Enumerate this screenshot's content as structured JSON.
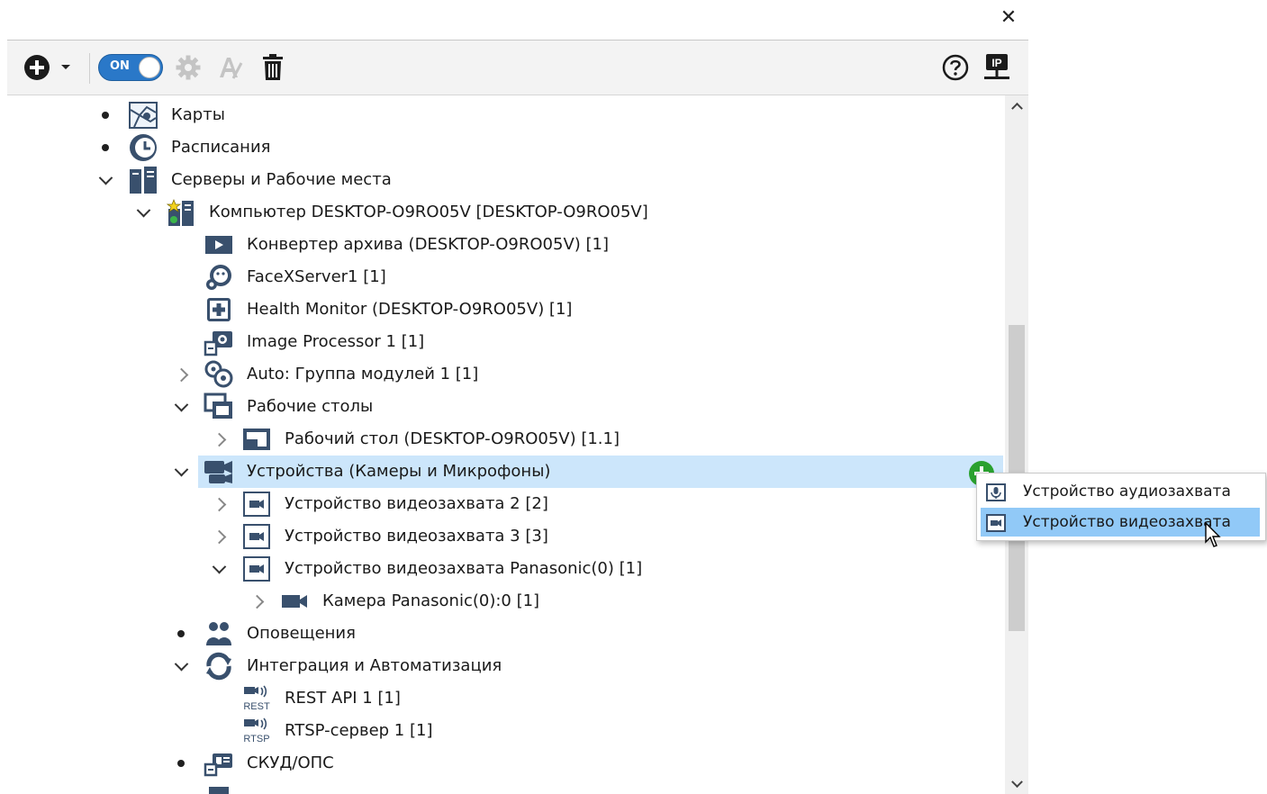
{
  "window": {
    "close_glyph": "✕"
  },
  "toolbar": {
    "add_icon": "plus-circle-icon",
    "toggle_label": "ON",
    "settings_icon": "gear-icon",
    "rename_icon": "rename-icon",
    "delete_icon": "trash-icon",
    "help_icon": "question-icon",
    "ip_icon": "ip-network-icon"
  },
  "tree": {
    "items": [
      {
        "label": "Карты",
        "icon": "map-icon",
        "marker": "bullet"
      },
      {
        "label": "Расписания",
        "icon": "clock-icon",
        "marker": "bullet"
      },
      {
        "label": "Серверы и Рабочие места",
        "icon": "servers-icon",
        "marker": "expanded"
      },
      {
        "label": "Компьютер DESKTOP-O9RO05V [DESKTOP-O9RO05V]",
        "icon": "computer-server-icon",
        "marker": "expanded"
      },
      {
        "label": "Конвертер архива (DESKTOP-O9RO05V) [1]",
        "icon": "archive-converter-icon",
        "marker": "none"
      },
      {
        "label": "FaceXServer1 [1]",
        "icon": "face-server-icon",
        "marker": "none"
      },
      {
        "label": "Health Monitor (DESKTOP-O9RO05V) [1]",
        "icon": "health-monitor-icon",
        "marker": "none"
      },
      {
        "label": "Image Processor 1 [1]",
        "icon": "image-processor-icon",
        "marker": "none"
      },
      {
        "label": "Auto: Группа модулей 1 [1]",
        "icon": "module-group-icon",
        "marker": "collapsed"
      },
      {
        "label": "Рабочие столы",
        "icon": "desktops-icon",
        "marker": "expanded"
      },
      {
        "label": "Рабочий стол (DESKTOP-O9RO05V) [1.1]",
        "icon": "desktop-icon",
        "marker": "collapsed"
      },
      {
        "label": "Устройства (Камеры и Микрофоны)",
        "icon": "devices-icon",
        "marker": "expanded",
        "selected": true
      },
      {
        "label": "Устройство видеозахвата 2 [2]",
        "icon": "video-capture-icon",
        "marker": "collapsed"
      },
      {
        "label": "Устройство видеозахвата 3 [3]",
        "icon": "video-capture-icon",
        "marker": "collapsed"
      },
      {
        "label": "Устройство видеозахвата Panasonic(0) [1]",
        "icon": "video-capture-icon",
        "marker": "expanded"
      },
      {
        "label": "Камера Panasonic(0):0 [1]",
        "icon": "camera-icon",
        "marker": "collapsed"
      },
      {
        "label": "Оповещения",
        "icon": "notifications-icon",
        "marker": "bullet"
      },
      {
        "label": "Интеграция и Автоматизация",
        "icon": "integration-icon",
        "marker": "expanded"
      },
      {
        "label": "REST API 1 [1]",
        "icon": "rest-api-icon",
        "marker": "none",
        "icon_text": "REST"
      },
      {
        "label": "RTSP-сервер 1 [1]",
        "icon": "rtsp-server-icon",
        "marker": "none",
        "icon_text": "RTSP"
      },
      {
        "label": "СКУД/ОПС",
        "icon": "access-control-icon",
        "marker": "bullet"
      }
    ]
  },
  "context_menu": {
    "items": [
      {
        "label": "Устройство аудиозахвата",
        "icon": "microphone-icon",
        "highlighted": false
      },
      {
        "label": "Устройство видеозахвата",
        "icon": "video-capture-icon",
        "highlighted": true
      }
    ]
  },
  "colors": {
    "accent": "#2a78c8",
    "selected_row": "#cce6fb",
    "menu_highlight": "#91c9f7",
    "add_green": "#2aa12f"
  }
}
